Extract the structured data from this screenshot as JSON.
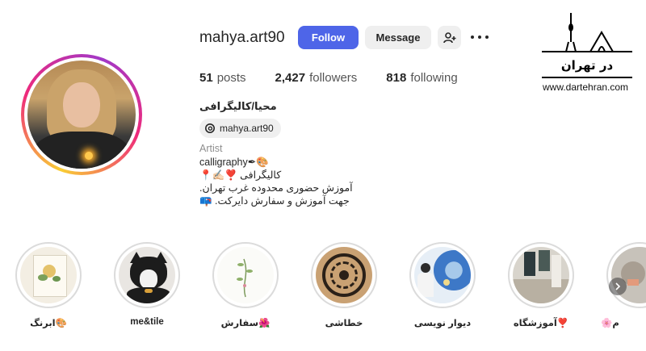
{
  "profile": {
    "username": "mahya.art90",
    "follow_label": "Follow",
    "message_label": "Message",
    "stats": {
      "posts_count": "51",
      "posts_label": "posts",
      "followers_count": "2,427",
      "followers_label": "followers",
      "following_count": "818",
      "following_label": "following"
    },
    "full_name": "محیا/کالیگرافی",
    "threads_handle": "mahya.art90",
    "category": "Artist",
    "bio_lines": [
      "calligraphy✒🎨",
      "📍✍🏻❣️ کالیگرافی",
      ".آموزش حضوری محدوده غرب تهران",
      "📪 .جهت آموزش و سفارش دایرکت"
    ]
  },
  "watermark": {
    "logo_text": "در تهران",
    "site": "www.dartehran.com"
  },
  "highlights": [
    {
      "label": "ابرنگ🎨",
      "icon": "flower-painting-image"
    },
    {
      "label": "me&tile",
      "icon": "cat-image"
    },
    {
      "label": "سفارش🌺",
      "icon": "botanical-drawing-image"
    },
    {
      "label": "خطاشی",
      "icon": "round-calligraphy-image"
    },
    {
      "label": "دیوار نویسی",
      "icon": "mural-image"
    },
    {
      "label": "آموزشگاه❣️",
      "icon": "classroom-image"
    },
    {
      "label": "🌸م",
      "icon": "partial-highlight-image"
    }
  ],
  "colors": {
    "follow_button": "#4e65e8",
    "secondary_button": "#efefef",
    "muted_text": "#8e8e8e"
  }
}
